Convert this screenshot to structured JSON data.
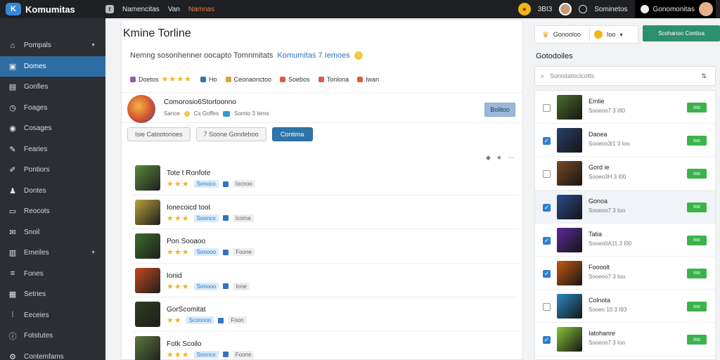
{
  "header": {
    "brand": "Komumitas",
    "brand_logo": "K",
    "nav": [
      "Namencitas",
      "Van",
      "Namnas"
    ],
    "coin_value": "3BI3",
    "user_link": "Sominetos",
    "user_name": "Gonomonitas"
  },
  "sidebar": {
    "items": [
      {
        "label": "Pompals",
        "icon": "home-icon",
        "glyph": "⌂",
        "caret": true,
        "active": false
      },
      {
        "label": "Domes",
        "icon": "grid-icon",
        "glyph": "▣",
        "caret": false,
        "active": true
      },
      {
        "label": "Gonfies",
        "icon": "list-icon",
        "glyph": "▤",
        "caret": false,
        "active": false
      },
      {
        "label": "Foages",
        "icon": "clock-icon",
        "glyph": "◷",
        "caret": false,
        "active": false
      },
      {
        "label": "Cosages",
        "icon": "pin-icon",
        "glyph": "◉",
        "caret": false,
        "active": false
      },
      {
        "label": "Fearies",
        "icon": "brush-icon",
        "glyph": "✎",
        "caret": false,
        "active": false
      },
      {
        "label": "Pontiors",
        "icon": "wrench-icon",
        "glyph": "✐",
        "caret": false,
        "active": false
      },
      {
        "label": "Dontes",
        "icon": "users-icon",
        "glyph": "♟",
        "caret": false,
        "active": false
      },
      {
        "label": "Reocots",
        "icon": "monitor-icon",
        "glyph": "▭",
        "caret": false,
        "active": false
      },
      {
        "label": "Snoil",
        "icon": "chat-icon",
        "glyph": "✉",
        "caret": false,
        "active": false
      },
      {
        "label": "Emeiles",
        "icon": "book-icon",
        "glyph": "▥",
        "caret": true,
        "active": false
      },
      {
        "label": "Fones",
        "icon": "menu-icon",
        "glyph": "≡",
        "caret": false,
        "active": false
      },
      {
        "label": "Setries",
        "icon": "layers-icon",
        "glyph": "▦",
        "caret": false,
        "active": false
      },
      {
        "label": "Eeceies",
        "icon": "apps-icon",
        "glyph": "⁞",
        "caret": false,
        "active": false
      },
      {
        "label": "Fotstutes",
        "icon": "info-icon",
        "glyph": "ⓘ",
        "caret": false,
        "active": false
      },
      {
        "label": "Contemfams",
        "icon": "settings-icon",
        "glyph": "⚙",
        "caret": false,
        "active": false
      }
    ]
  },
  "main": {
    "title": "Kmine Torline",
    "info_text": "Nemng sosonhenner oocapto  Tomnmitats",
    "info_link": "Komumitas  7  Iemoes",
    "tags": [
      {
        "label": "Doetos",
        "color": "#9b59b6",
        "stars": "★★★★"
      },
      {
        "label": "Ho",
        "color": "#2e74c4",
        "stars": ""
      },
      {
        "label": "Ceonaonctoo",
        "color": "#e0a13a",
        "stars": ""
      },
      {
        "label": "Soebos",
        "color": "#e05c3a",
        "stars": ""
      },
      {
        "label": "Tonlona",
        "color": "#e05c3a",
        "stars": ""
      },
      {
        "label": "Iwan",
        "color": "#e05c3a",
        "stars": ""
      }
    ],
    "product": {
      "title": "Comorosio6Stortoonno",
      "sub1": "Sance",
      "sub2": "Cs Goffes",
      "sub3": "Somto  3  Iems",
      "button": "Bolitoo"
    },
    "filters": [
      "Isie Catootonoes",
      "7  Soone Gondeboo",
      "Contima"
    ],
    "results": [
      {
        "title": "Tote  t  Ronfote",
        "stars": "★★★",
        "pill": "Sonoco",
        "pill2": "Iocnoo",
        "color": "#5a8a3a"
      },
      {
        "title": "Ionecoicd toot",
        "stars": "★★★",
        "pill": "Soonco",
        "pill2": "Icoma",
        "color": "#b8a23a"
      },
      {
        "title": "Pon Sooaoo",
        "stars": "★★★",
        "pill": "Sonooo",
        "pill2": "Foone",
        "color": "#3d6e2c"
      },
      {
        "title": "Ionid",
        "stars": "★★★",
        "pill": "Sonooo",
        "pill2": "Ione",
        "color": "#c4491f"
      },
      {
        "title": "GorScomitat",
        "stars": "★★",
        "pill": "Scoonoo",
        "pill2": "Foon",
        "color": "#2f3d1e"
      },
      {
        "title": "Fotk  Scoilo",
        "stars": "★★★",
        "pill": "Soonco",
        "pill2": "Foone",
        "color": "#5c7a3c"
      }
    ]
  },
  "right": {
    "top_label": "Gonooloo",
    "top_small": "Ioo",
    "action": "Scohanoo Contioa",
    "section_label": "Gotodoiles",
    "search_placeholder": "Sonistatoclcotts",
    "items": [
      {
        "name": "Emlie",
        "meta": "Sooeoo7  3  I80",
        "checked": false,
        "selected": false,
        "color": "#4c6e2c",
        "btn": "Ioo"
      },
      {
        "name": "Daoea",
        "meta": "Sooeoo3I1  3  Ioo",
        "checked": true,
        "selected": false,
        "color": "#2a3f6a",
        "btn": "Ioo"
      },
      {
        "name": "Gord  ie",
        "meta": "Sooeo3H  3  I00",
        "checked": false,
        "selected": false,
        "color": "#7a4a24",
        "btn": "Ioo"
      },
      {
        "name": "Gonoa",
        "meta": "Sooeoo7  3  Ioo",
        "checked": true,
        "selected": true,
        "color": "#2b4a8a",
        "btn": "Ioo"
      },
      {
        "name": "Tatia",
        "meta": "Sooeo0A11  3  I00",
        "checked": true,
        "selected": false,
        "color": "#5c2a9a",
        "btn": "Ioo"
      },
      {
        "name": "Foooolt",
        "meta": "Sooeoo7  3  Ioo",
        "checked": true,
        "selected": false,
        "color": "#c45a12",
        "btn": "Ioo"
      },
      {
        "name": "Colnota",
        "meta": "Sooeo  10  3  I93",
        "checked": false,
        "selected": false,
        "color": "#2a8ac4",
        "btn": "Ioo"
      },
      {
        "name": "Iatohanre",
        "meta": "Sooeoo7  3  Ioo",
        "checked": true,
        "selected": false,
        "color": "#8ac43a",
        "btn": "Ioo"
      }
    ]
  }
}
